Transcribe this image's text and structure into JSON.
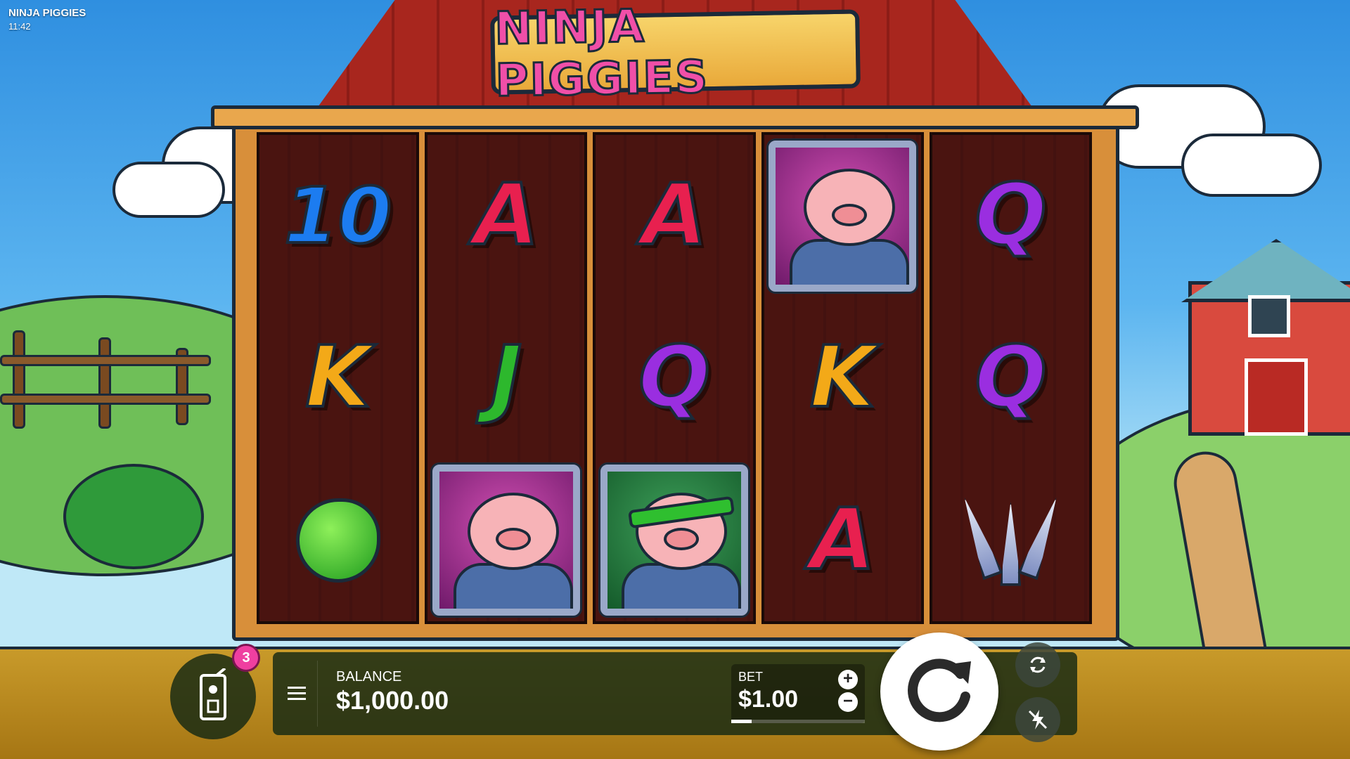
{
  "game": {
    "title": "NINJA PIGGIES",
    "clock": "11:42",
    "logo_text": "NINJA PIGGIES"
  },
  "reels": [
    [
      "10",
      "K",
      "apple"
    ],
    [
      "A",
      "J",
      "pig-purple"
    ],
    [
      "A",
      "Q",
      "pig-green"
    ],
    [
      "pig-purple",
      "K",
      "A"
    ],
    [
      "Q",
      "Q",
      "shuriken"
    ]
  ],
  "controls": {
    "balance_label": "BALANCE",
    "balance_value": "$1,000.00",
    "bet_label": "BET",
    "bet_value": "$1.00",
    "bet_plus": "+",
    "bet_minus": "−",
    "menu_icon": "hamburger-icon",
    "spin_icon": "spin-arrow-icon",
    "autoplay_icon": "autoplay-icon",
    "turbo_icon": "turbo-off-icon",
    "bonus_buy_icon": "bonus-buy-icon",
    "bonus_badge": "3",
    "bet_level_fraction": 0.15
  },
  "colors": {
    "letter_10": "#1c7cf0",
    "letter_a": "#e8204f",
    "letter_q": "#9a2ee0",
    "letter_k": "#f3a918",
    "letter_j": "#2db82d",
    "badge": "#ef3fa0"
  }
}
